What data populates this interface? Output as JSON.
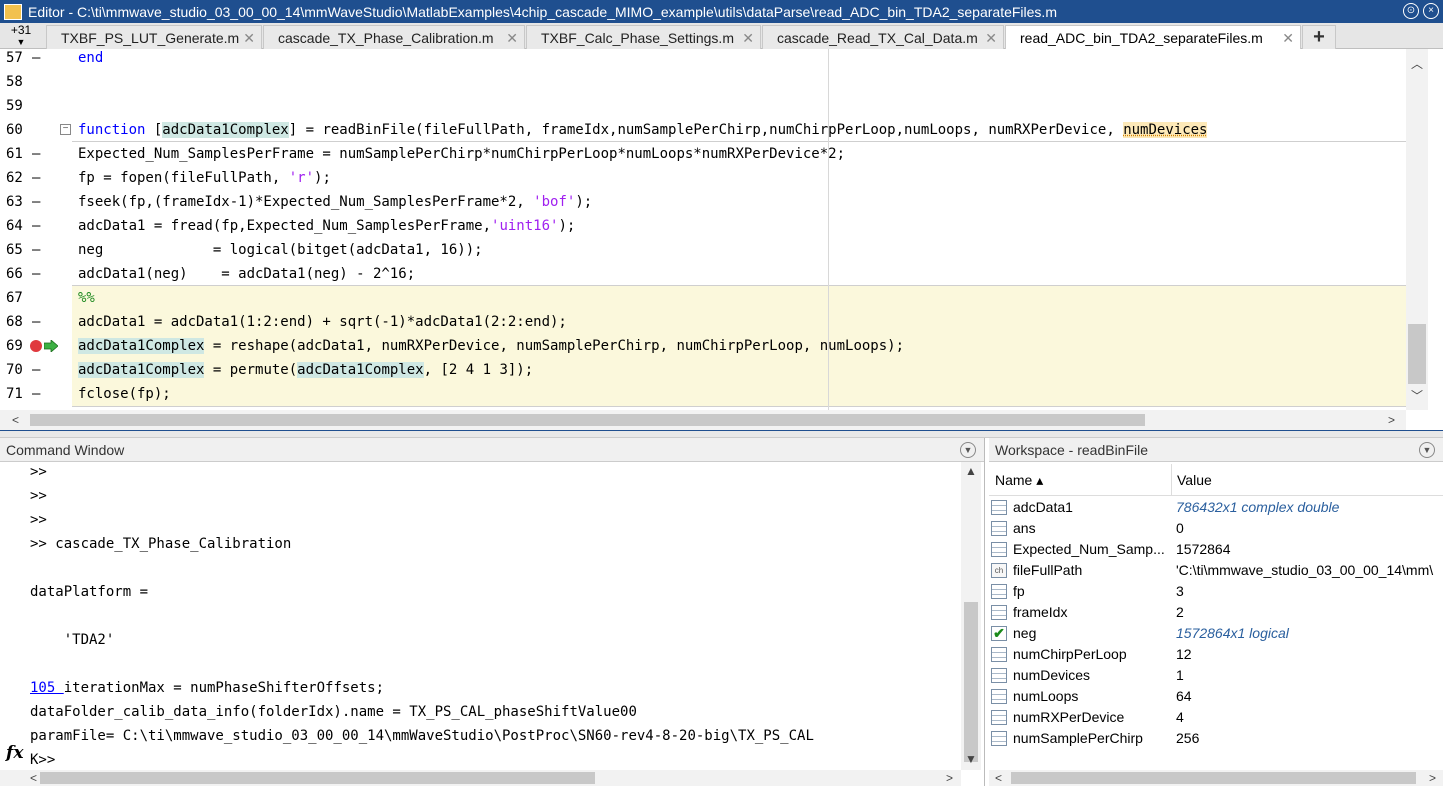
{
  "titlebar": {
    "title": "Editor - C:\\ti\\mmwave_studio_03_00_00_14\\mmWaveStudio\\MatlabExamples\\4chip_cascade_MIMO_example\\utils\\dataParse\\read_ADC_bin_TDA2_separateFiles.m",
    "menu_glyph": "⊙",
    "close_glyph": "×"
  },
  "tabs": {
    "files_badge": "+31",
    "items": [
      {
        "label": "TXBF_PS_LUT_Generate.m"
      },
      {
        "label": "cascade_TX_Phase_Calibration.m"
      },
      {
        "label": "TXBF_Calc_Phase_Settings.m"
      },
      {
        "label": "cascade_Read_TX_Cal_Data.m"
      },
      {
        "label": "read_ADC_bin_TDA2_separateFiles.m"
      }
    ],
    "close_glyph": "✕",
    "add_glyph": "+"
  },
  "editor": {
    "line_numbers": [
      "57",
      "58",
      "59",
      "60",
      "61",
      "62",
      "63",
      "64",
      "65",
      "66",
      "67",
      "68",
      "69",
      "70",
      "71"
    ],
    "dash": "–",
    "fold_glyph": "−",
    "lines": {
      "l57": "end",
      "l60_kw": "function",
      "l60_a": " [",
      "l60_b": "adcData1Complex",
      "l60_c": "] = readBinFile(fileFullPath, frameIdx,numSamplePerChirp,numChirpPerLoop,numLoops, numRXPerDevice, ",
      "l60_d": "numDevices",
      "l61": "Expected_Num_SamplesPerFrame = numSamplePerChirp*numChirpPerLoop*numLoops*numRXPerDevice*2;",
      "l62_a": "fp = fopen(fileFullPath, ",
      "l62_s": "'r'",
      "l62_b": ");",
      "l63_a": "fseek(fp,(frameIdx-1)*Expected_Num_SamplesPerFrame*2, ",
      "l63_s": "'bof'",
      "l63_b": ");",
      "l64_a": "adcData1 = fread(fp,Expected_Num_SamplesPerFrame,",
      "l64_s": "'uint16'",
      "l64_b": ");",
      "l65": "neg             = logical(bitget(adcData1, 16));",
      "l66": "adcData1(neg)    = adcData1(neg) - 2^16;",
      "l67": "%%",
      "l68": "adcData1 = adcData1(1:2:end) + sqrt(-1)*adcData1(2:2:end);",
      "l69_a": "adcData1Complex",
      "l69_b": " = reshape(adcData1, numRXPerDevice, numSamplePerChirp, numChirpPerLoop, numLoops);",
      "l70_a": "adcData1Complex",
      "l70_b": " = permute(",
      "l70_c": "adcData1Complex",
      "l70_d": ", [2 4 1 3]);",
      "l71": "fclose(fp);"
    }
  },
  "command_window": {
    "title": "Command Window",
    "lines": {
      "c1": ">>",
      "c2": ">>",
      "c3": ">>",
      "c4": ">> cascade_TX_Phase_Calibration",
      "c5": "dataPlatform =",
      "c6": "    'TDA2'",
      "c7_link": "105 ",
      "c7_rest": "iterationMax = numPhaseShifterOffsets;",
      "c8": "dataFolder_calib_data_info(folderIdx).name = TX_PS_CAL_phaseShiftValue00",
      "c9": "paramFile= C:\\ti\\mmwave_studio_03_00_00_14\\mmWaveStudio\\PostProc\\SN60-rev4-8-20-big\\TX_PS_CAL",
      "c10": "K>>"
    },
    "fx_label": "fx"
  },
  "workspace": {
    "title": "Workspace - readBinFile",
    "col_name": "Name ▴",
    "col_value": "Value",
    "rows": [
      {
        "name": "adcData1",
        "value": "786432x1 complex double"
      },
      {
        "name": "ans",
        "value": "0"
      },
      {
        "name": "Expected_Num_Samp...",
        "value": "1572864"
      },
      {
        "name": "fileFullPath",
        "value": "'C:\\ti\\mmwave_studio_03_00_00_14\\mm\\"
      },
      {
        "name": "fp",
        "value": "3"
      },
      {
        "name": "frameIdx",
        "value": "2"
      },
      {
        "name": "neg",
        "value": "1572864x1 logical"
      },
      {
        "name": "numChirpPerLoop",
        "value": "12"
      },
      {
        "name": "numDevices",
        "value": "1"
      },
      {
        "name": "numLoops",
        "value": "64"
      },
      {
        "name": "numRXPerDevice",
        "value": "4"
      },
      {
        "name": "numSamplePerChirp",
        "value": "256"
      }
    ],
    "cell_icon_label": "ch",
    "check_glyph": "✔"
  },
  "scroll": {
    "up": "▲",
    "down": "▼",
    "left": "<",
    "right": ">",
    "small_up": "︿",
    "small_down": "﹀"
  }
}
